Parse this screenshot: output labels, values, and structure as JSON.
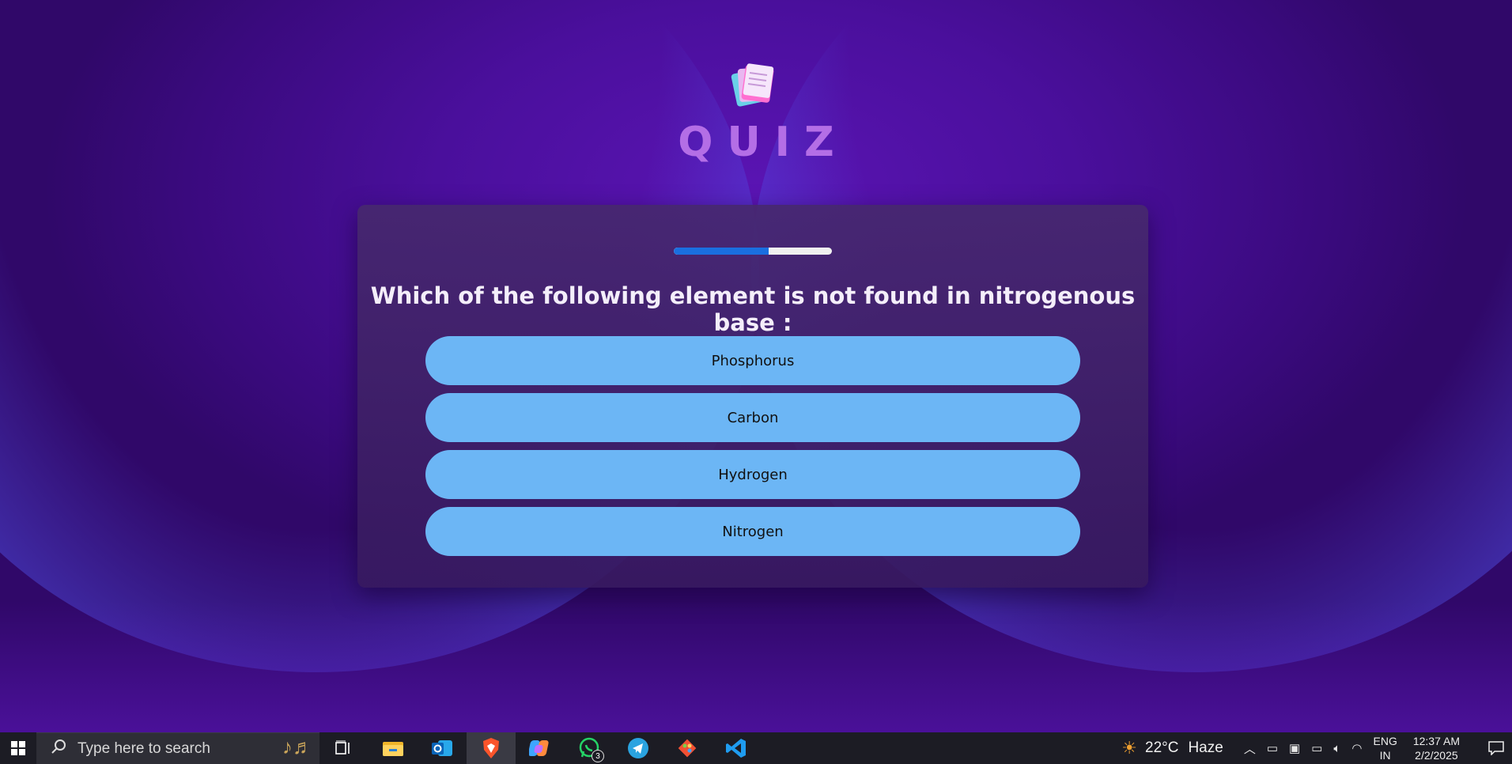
{
  "app": {
    "title": "QUIZ"
  },
  "quiz": {
    "progress": 0.6,
    "question": "Which of the following element is not found in nitrogenous base :",
    "options": [
      "Phosphorus",
      "Carbon",
      "Hydrogen",
      "Nitrogen"
    ]
  },
  "colors": {
    "background": "#4a0f9c",
    "title": "#b46ee6",
    "card": "#46286e",
    "option": "#6cb6f5",
    "progress_fill": "#1a6fe0",
    "progress_track": "#f0f0f0"
  },
  "taskbar": {
    "search_placeholder": "Type here to search",
    "apps": [
      "task-view-icon",
      "file-explorer-icon",
      "outlook-icon",
      "brave-icon",
      "copilot-icon",
      "whatsapp-icon",
      "telegram-icon",
      "git-icon",
      "vscode-icon"
    ],
    "whatsapp_badge": "3",
    "weather": {
      "temp": "22°C",
      "condition": "Haze"
    },
    "language": {
      "line1": "ENG",
      "line2": "IN"
    },
    "clock": {
      "time": "12:37 AM",
      "date": "2/2/2025"
    }
  }
}
